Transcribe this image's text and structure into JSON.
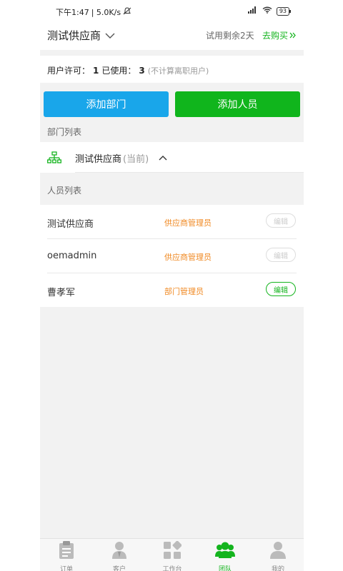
{
  "status_bar": {
    "time": "下午1:47",
    "network": "| 5.0K/s",
    "battery": "93"
  },
  "header": {
    "title": "测试供应商",
    "trial_text": "试用剩余2天",
    "buy_label": "去购买"
  },
  "license": {
    "permit_label": "用户许可：",
    "permit_count": "1",
    "used_label": "已使用：",
    "used_count": "3",
    "note": "(不计算离职用户)"
  },
  "actions": {
    "add_department": "添加部门",
    "add_person": "添加人员"
  },
  "department_section": {
    "label": "部门列表",
    "current_name": "测试供应商",
    "current_tag": "(当前)"
  },
  "people_section": {
    "label": "人员列表",
    "rows": [
      {
        "name": "测试供应商",
        "role": "供应商管理员",
        "edit": "编辑"
      },
      {
        "name": "oemadmin",
        "role": "供应商管理员",
        "edit": "编辑"
      },
      {
        "name": "曹孝军",
        "role": "部门管理员",
        "edit": "编辑"
      }
    ]
  },
  "bottom_nav": {
    "items": [
      {
        "label": "订单",
        "icon": "clipboard-icon"
      },
      {
        "label": "客户",
        "icon": "person-icon"
      },
      {
        "label": "工作台",
        "icon": "grid-icon"
      },
      {
        "label": "团队",
        "icon": "team-icon"
      },
      {
        "label": "我的",
        "icon": "profile-icon"
      }
    ],
    "active": "团队"
  },
  "colors": {
    "green": "#14b41e",
    "blue": "#19a6ea",
    "orange": "#f08a24",
    "background": "#f2f2f2"
  }
}
